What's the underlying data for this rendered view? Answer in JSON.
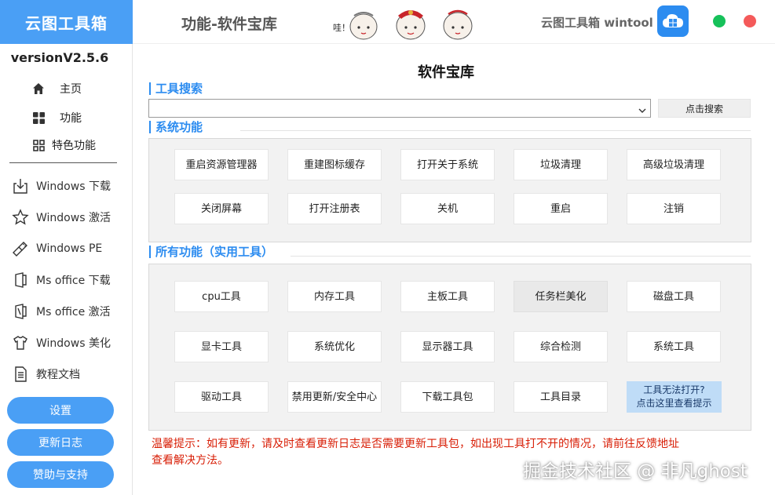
{
  "sidebar": {
    "brand": "云图工具箱",
    "version": "versionV2.5.6",
    "top_nav": [
      {
        "label": "主页",
        "icon": "home-icon"
      },
      {
        "label": "功能",
        "icon": "grid-icon"
      },
      {
        "label": "特色功能",
        "icon": "grid-outline-icon"
      }
    ],
    "items": [
      {
        "label": "Windows 下载",
        "icon": "download-icon"
      },
      {
        "label": "Windows 激活",
        "icon": "star-icon"
      },
      {
        "label": "Windows PE",
        "icon": "usb-icon"
      },
      {
        "label": "Ms office 下载",
        "icon": "office-icon"
      },
      {
        "label": "Ms office 激活",
        "icon": "office-key-icon"
      },
      {
        "label": "Windows 美化",
        "icon": "shirt-icon"
      },
      {
        "label": "教程文档",
        "icon": "document-icon"
      }
    ],
    "buttons": [
      "设置",
      "更新日志",
      "赞助与支持"
    ]
  },
  "header": {
    "title": "功能-软件宝库",
    "right_title": "云图工具箱 wintool",
    "mascot_text": "哇！"
  },
  "main": {
    "page_title": "软件宝库",
    "search": {
      "label": "工具搜索",
      "value": "",
      "button": "点击搜索"
    },
    "system": {
      "label": "系统功能",
      "buttons": [
        [
          "重启资源管理器",
          "重建图标缓存",
          "打开关于系统",
          "垃圾清理",
          "高级垃圾清理"
        ],
        [
          "关闭屏幕",
          "打开注册表",
          "关机",
          "重启",
          "注销"
        ]
      ]
    },
    "all": {
      "label": "所有功能（实用工具）",
      "buttons": [
        [
          "cpu工具",
          "内存工具",
          "主板工具",
          "任务栏美化",
          "磁盘工具"
        ],
        [
          "显卡工具",
          "系统优化",
          "显示器工具",
          "综合检测",
          "系统工具"
        ],
        [
          "驱动工具",
          "禁用更新/安全中心",
          "下载工具包",
          "工具目录"
        ]
      ],
      "hint_line1": "工具无法打开?",
      "hint_line2": "点击这里查看提示"
    },
    "tip_line1": "温馨提示：如有更新，请及时查看更新日志是否需要更新工具包，如出现工具打不开的情况，请前往反馈地址",
    "tip_line2": "查看解决方法。"
  },
  "watermark": "掘金技术社区 @ 非凡ghost",
  "colors": {
    "accent": "#4a9ff5",
    "heading_blue": "#2c8cf0",
    "warning": "#d81e06",
    "minimize": "#16c15a",
    "close": "#f45a5a"
  }
}
